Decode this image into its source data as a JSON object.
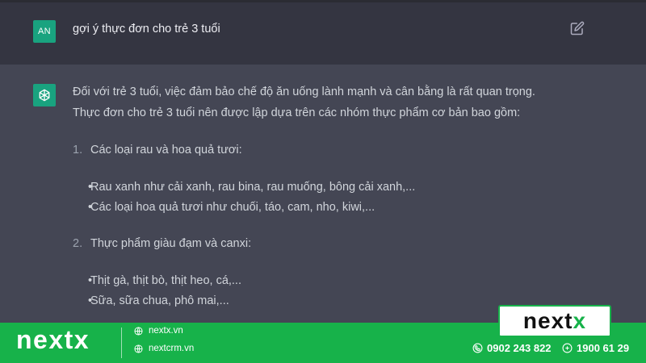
{
  "user_message": {
    "avatar": "AN",
    "text": "gợi ý thực đơn cho trẻ 3 tuổi"
  },
  "assistant_message": {
    "intro_line1": "Đối với trẻ 3 tuổi, việc đảm bảo chế độ ăn uống lành mạnh và cân bằng là rất quan trọng.",
    "intro_line2": "Thực đơn cho trẻ 3 tuổi nên được lập dựa trên các nhóm thực phẩm cơ bản bao gồm:",
    "sections": [
      {
        "number": "1.",
        "title": "Các loại rau và hoa quả tươi:",
        "bullets": [
          "Rau xanh như cải xanh, rau bina, rau muống, bông cải xanh,...",
          "Các loại hoa quả tươi như chuối, táo, cam, nho, kiwi,..."
        ]
      },
      {
        "number": "2.",
        "title": "Thực phẩm giàu đạm và canxi:",
        "bullets": [
          "Thịt gà, thịt bò, thịt heo, cá,...",
          "Sữa, sữa chua, phô mai,..."
        ]
      }
    ]
  },
  "footer": {
    "brand": "nextx",
    "site1": "nextx.vn",
    "site2": "nextcrm.vn",
    "logo_main": "next",
    "logo_accent": "x",
    "phone1": "0902 243 822",
    "phone2": "1900 61 29",
    "bg_color": "#17b24a"
  },
  "icons": {
    "edit": "edit-icon",
    "bot": "openai-logo-icon",
    "globe": "globe-icon",
    "phone": "phone-icon",
    "hotline": "hotline-icon"
  }
}
